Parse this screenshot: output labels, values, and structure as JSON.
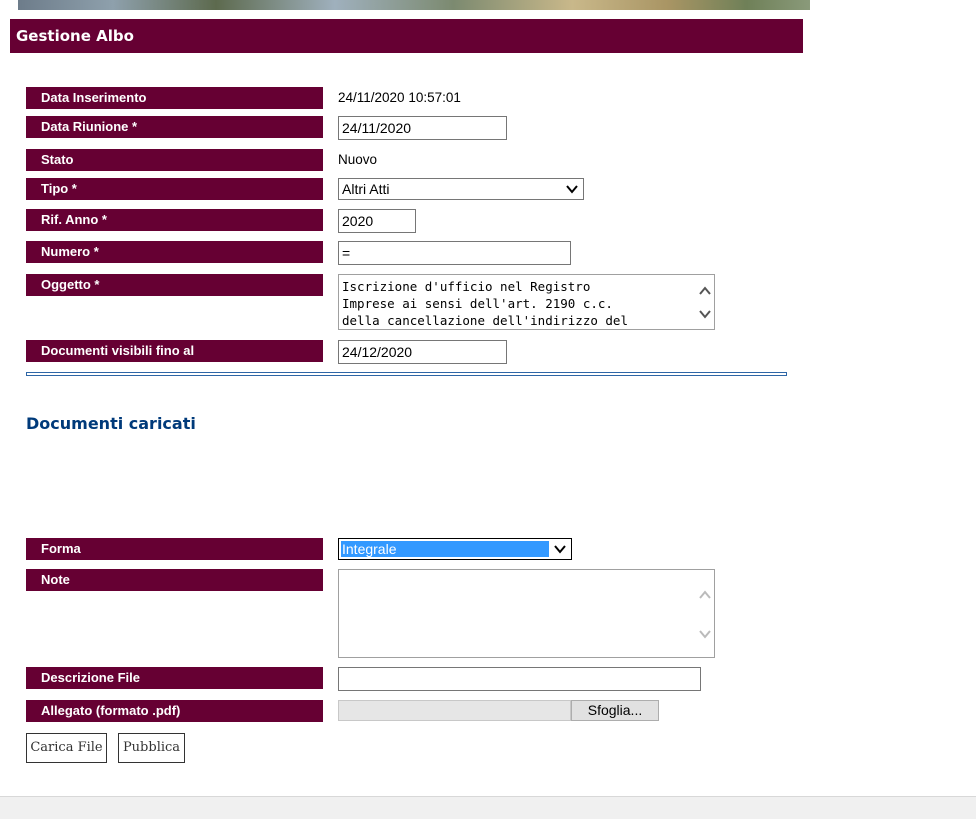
{
  "page": {
    "title": "Gestione Albo"
  },
  "form": {
    "data_inserimento": {
      "label": "Data Inserimento",
      "value": "24/11/2020 10:57:01"
    },
    "data_riunione": {
      "label": "Data Riunione *",
      "value": "24/11/2020"
    },
    "stato": {
      "label": "Stato",
      "value": "Nuovo"
    },
    "tipo": {
      "label": "Tipo *",
      "value": "Altri Atti"
    },
    "rif_anno": {
      "label": "Rif. Anno *",
      "value": "2020"
    },
    "numero": {
      "label": "Numero *",
      "value": "="
    },
    "oggetto": {
      "label": "Oggetto *",
      "value": "Iscrizione d'ufficio nel Registro\nImprese ai sensi dell'art. 2190 c.c.\ndella cancellazione dell'indirizzo del"
    },
    "documenti_visibili": {
      "label": "Documenti visibili fino al",
      "value": "24/12/2020"
    }
  },
  "documents": {
    "section_title": "Documenti caricati",
    "forma": {
      "label": "Forma",
      "value": "Integrale"
    },
    "note": {
      "label": "Note",
      "value": ""
    },
    "descrizione_file": {
      "label": "Descrizione File",
      "value": ""
    },
    "allegato": {
      "label": "Allegato (formato .pdf)",
      "browse_label": "Sfoglia..."
    }
  },
  "actions": {
    "upload_label": "Carica File",
    "publish_label": "Pubblica"
  },
  "colors": {
    "label_bg": "#660033",
    "section_title": "#003a7a",
    "separator": "#2e66a6",
    "selected_option": "#3399ff"
  }
}
